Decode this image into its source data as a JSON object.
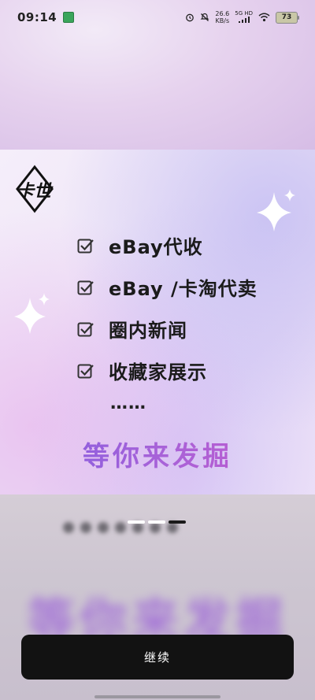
{
  "status_bar": {
    "time": "09:14",
    "net_speed_value": "26.6",
    "net_speed_unit": "KB/s",
    "network_type": "5G HD",
    "battery_level": "73"
  },
  "logo": {
    "text": "卡世"
  },
  "features": [
    {
      "label": "eBay代收"
    },
    {
      "label": "eBay /卡淘代卖"
    },
    {
      "label": "圈内新闻"
    },
    {
      "label": "收藏家展示"
    }
  ],
  "ellipsis": "……",
  "slogan": "等你来发掘",
  "blurred_slogan": "等你来发掘",
  "pager": {
    "total": 3,
    "active_index": 2
  },
  "continue_label": "继续",
  "colors": {
    "accent_start": "#7d5ce2",
    "accent_end": "#c45acd",
    "button_bg": "#121212"
  }
}
